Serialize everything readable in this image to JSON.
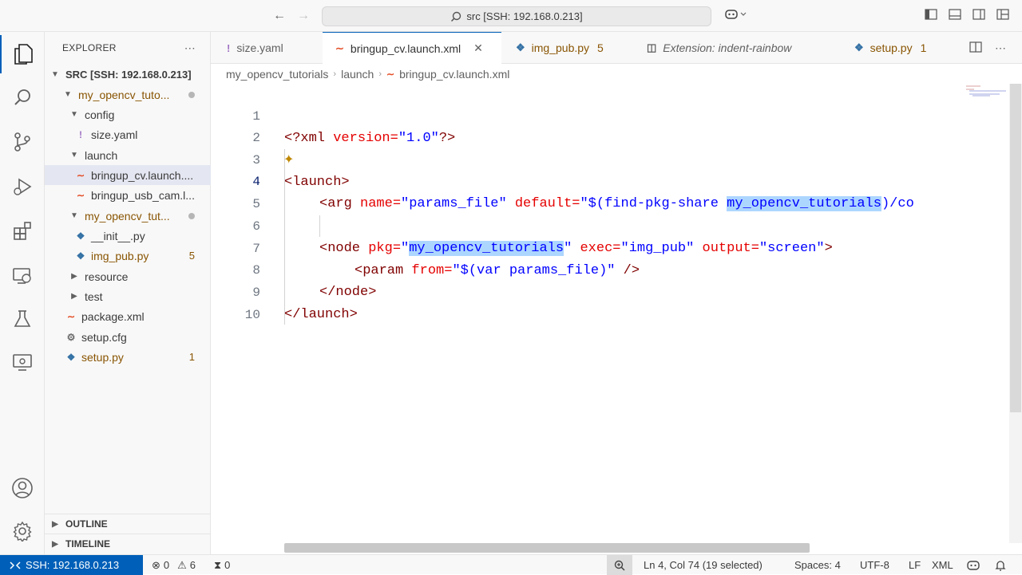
{
  "titlebar": {
    "command_center": "src [SSH: 192.168.0.213]",
    "back_icon": "arrow-left-icon",
    "forward_icon": "arrow-right-icon"
  },
  "sidebar": {
    "title": "EXPLORER",
    "root": "SRC [SSH: 192.168.0.213]",
    "tree": [
      {
        "label": "my_opencv_tuto...",
        "type": "folder"
      },
      {
        "label": "config",
        "type": "folder"
      },
      {
        "label": "size.yaml",
        "type": "yaml"
      },
      {
        "label": "launch",
        "type": "folder"
      },
      {
        "label": "bringup_cv.launch....",
        "type": "xml",
        "selected": true
      },
      {
        "label": "bringup_usb_cam.l...",
        "type": "xml"
      },
      {
        "label": "my_opencv_tut...",
        "type": "folder"
      },
      {
        "label": "__init__.py",
        "type": "py"
      },
      {
        "label": "img_pub.py",
        "type": "py",
        "badge": "5"
      },
      {
        "label": "resource",
        "type": "folder"
      },
      {
        "label": "test",
        "type": "folder"
      },
      {
        "label": "package.xml",
        "type": "xml"
      },
      {
        "label": "setup.cfg",
        "type": "cfg"
      },
      {
        "label": "setup.py",
        "type": "py",
        "badge": "1"
      }
    ],
    "outline": "OUTLINE",
    "timeline": "TIMELINE"
  },
  "tabs": [
    {
      "label": "size.yaml",
      "icon": "!"
    },
    {
      "label": "bringup_cv.launch.xml",
      "icon": "rss-xml-icon",
      "active": true
    },
    {
      "label": "img_pub.py",
      "badge": "5"
    },
    {
      "label": "Extension: indent-rainbow"
    },
    {
      "label": "setup.py",
      "badge": "1"
    }
  ],
  "breadcrumb": [
    "my_opencv_tutorials",
    "launch",
    "bringup_cv.launch.xml"
  ],
  "editor": {
    "line_numbers": [
      "1",
      "2",
      "3",
      "4",
      "5",
      "6",
      "7",
      "8",
      "9",
      "10"
    ],
    "current_line": 4,
    "l1": {
      "a": "<?xml",
      "b": " version=",
      "c": "\"1.0\"",
      "d": "?>"
    },
    "l3": {
      "a": "<launch>"
    },
    "l4": {
      "a": "<arg",
      "b": " name=",
      "c": "\"params_file\"",
      "d": " default=",
      "e": "\"$(find-pkg-share ",
      "f": "my_opencv_tutorials",
      "g": ")/co"
    },
    "l6": {
      "a": "<node",
      "b": " pkg=",
      "c": "\"",
      "d": "my_opencv_tutorials",
      "e": "\"",
      "f": " exec=",
      "g": "\"img_pub\"",
      "h": " output=",
      "i": "\"screen\"",
      "j": ">"
    },
    "l7": {
      "a": "<param",
      "b": " from=",
      "c": "\"$(var params_file)\"",
      "d": " />"
    },
    "l8": {
      "a": "</node>"
    },
    "l9": {
      "a": "</launch>"
    }
  },
  "statusbar": {
    "remote": "SSH: 192.168.0.213",
    "errors": "0",
    "warnings": "6",
    "ports": "0",
    "position": "Ln 4, Col 74 (19 selected)",
    "spaces": "Spaces: 4",
    "encoding": "UTF-8",
    "eol": "LF",
    "language": "XML"
  },
  "colors": {
    "accent": "#005fb8",
    "selection": "#add6ff",
    "xml_tag": "#800000",
    "xml_attr": "#e50000",
    "xml_string": "#0000ff",
    "modified": "#895503"
  }
}
